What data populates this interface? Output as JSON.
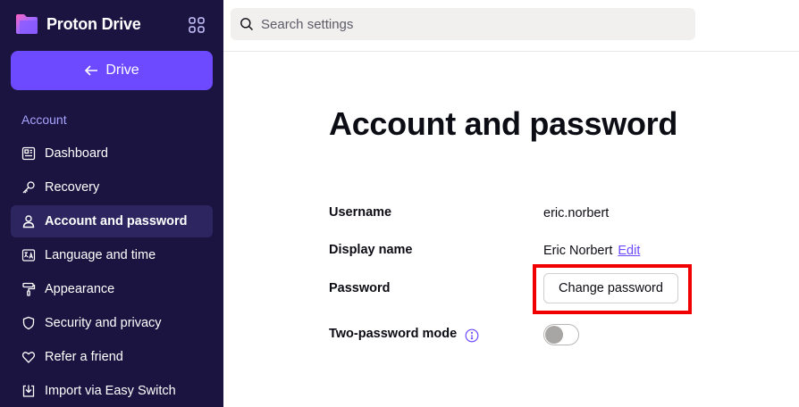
{
  "app": {
    "name": "Proton Drive"
  },
  "sidebar": {
    "back_button": "Drive",
    "section": "Account",
    "items": [
      {
        "label": "Dashboard",
        "icon": "dashboard-icon",
        "active": false
      },
      {
        "label": "Recovery",
        "icon": "key-icon",
        "active": false
      },
      {
        "label": "Account and password",
        "icon": "user-icon",
        "active": true
      },
      {
        "label": "Language and time",
        "icon": "language-icon",
        "active": false
      },
      {
        "label": "Appearance",
        "icon": "paint-roller-icon",
        "active": false
      },
      {
        "label": "Security and privacy",
        "icon": "shield-icon",
        "active": false
      },
      {
        "label": "Refer a friend",
        "icon": "heart-icon",
        "active": false
      },
      {
        "label": "Import via Easy Switch",
        "icon": "import-icon",
        "active": false
      }
    ]
  },
  "search": {
    "placeholder": "Search settings"
  },
  "main": {
    "title": "Account and password",
    "username_label": "Username",
    "username_value": "eric.norbert",
    "display_name_label": "Display name",
    "display_name_value": "Eric Norbert",
    "edit_label": "Edit",
    "password_label": "Password",
    "change_password_label": "Change password",
    "two_password_label": "Two-password mode",
    "two_password_enabled": false
  },
  "colors": {
    "sidebar_bg": "#1b1340",
    "accent": "#6d4aff",
    "active_item_bg": "#2d2560",
    "section_label": "#a7a4ff",
    "highlight": "#f00000"
  }
}
